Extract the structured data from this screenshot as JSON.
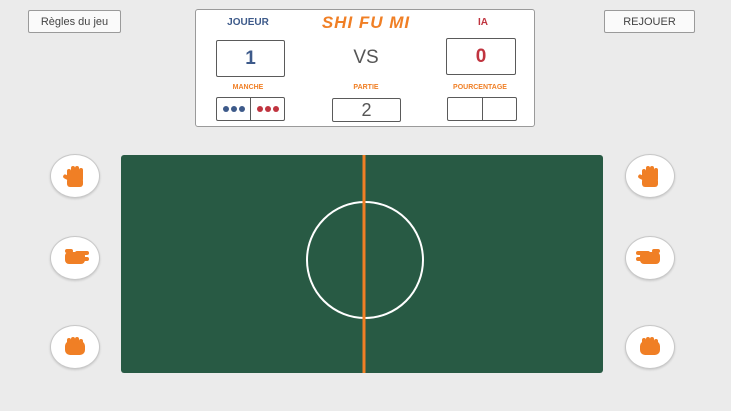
{
  "header": {
    "rules_label": "Règles du jeu",
    "replay_label": "REJOUER"
  },
  "scoreboard": {
    "player_label": "JOUEUR",
    "logo_text": "SHI FU MI",
    "ai_label": "IA",
    "player_score": "1",
    "vs_label": "VS",
    "ai_score": "0",
    "round_label": "MANCHE",
    "game_label": "PARTIE",
    "game_number": "2",
    "percentage_label": "POURCENTAGE",
    "percentage_left": "",
    "percentage_right": ""
  },
  "colors": {
    "player": "#3d5a8a",
    "ai": "#c0343f",
    "accent": "#f07f25",
    "field": "#285a44"
  },
  "player_hands": [
    "paper-hand-icon",
    "scissors-hand-icon",
    "rock-hand-icon"
  ],
  "ai_hands": [
    "paper-hand-icon",
    "scissors-hand-icon",
    "rock-hand-icon"
  ]
}
